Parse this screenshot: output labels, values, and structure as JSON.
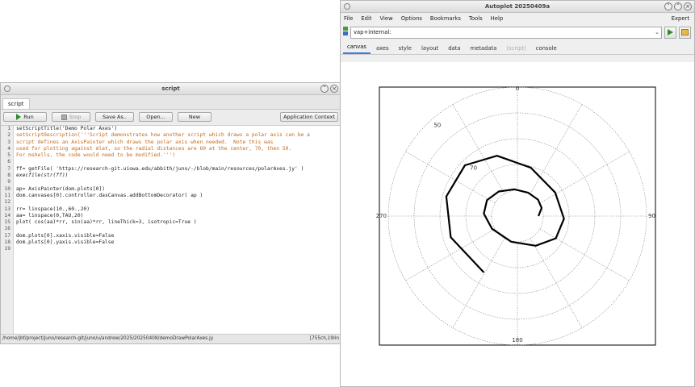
{
  "script_window": {
    "title": "script",
    "tab": "script",
    "toolbar": {
      "run": "Run",
      "stop": "Stop",
      "save_as": "Save As..",
      "open": "Open...",
      "new": "New",
      "context": "Application Context"
    },
    "code_lines": [
      "setScriptTitle('Demo Polar Axes')",
      "setScriptDescription('''Script demonstrates how another script which draws a polar axis can be a",
      "script defines an AxisPainter which draws the polar axis when needed.  Note this was",
      "used for plotting against mlat, so the radial distances are 60 at the center, 70, then 50.",
      "For mshells, the code would need to be modified.''')",
      "",
      "ff= getFile( 'https://research-git.uiowa.edu/abbith/juno/-/blob/main/resources/polarAxes.jy' )",
      "execfile(str(ff))",
      "",
      "ap= AxisPainter(dom.plots[0])",
      "dom.canvases[0].controller.dasCanvas.addBottomDecorator( ap )",
      "",
      "rr= linspace(10.,60.,20)",
      "aa= linspace(0,TAU,20)",
      "plot( cos(aa)*rr, sin(aa)*rr, lineThick=3, isotropic=True )",
      "",
      "dom.plots[0].xaxis.visible=False",
      "dom.plots[0].yaxis.visible=False",
      ""
    ],
    "status_path": "/home/jbf/project/juno/research-git/juno/u/andrew/2025/20250408/demoDrawPolarAxes.jy",
    "status_right": "[755ch,19lin"
  },
  "autoplot_window": {
    "title": "Autoplot 20250409a",
    "menu": [
      "File",
      "Edit",
      "View",
      "Options",
      "Bookmarks",
      "Tools",
      "Help"
    ],
    "expert": "Expert",
    "url_value": "vap+internal:",
    "tabs": [
      "canvas",
      "axes",
      "style",
      "layout",
      "data",
      "metadata",
      "(script)",
      "console"
    ],
    "active_tab": "canvas",
    "polar_labels": {
      "top": "0",
      "left": "270",
      "right": "90",
      "bottom": "180",
      "ring50": "50",
      "ring70": "70"
    }
  },
  "chart_data": {
    "type": "line",
    "title": "",
    "xlabel": "",
    "ylabel": "",
    "axes_visible": false,
    "series": [
      {
        "x": [
          10.0,
          11.48,
          9.75,
          5.18,
          -1.44,
          -8.85,
          -14.41,
          -15.91,
          -12.05,
          -2.95,
          8.63,
          18.22,
          22.06,
          17.91,
          6.31,
          -9.7,
          -24.87,
          -33.73,
          -31.61,
          -15.91
        ],
        "y": [
          0.0,
          3.88,
          7.81,
          11.05,
          12.69,
          11.66,
          7.55,
          1.16,
          -6.0,
          -12.15,
          -14.09,
          -10.55,
          -1.27,
          11.18,
          22.99,
          28.62,
          24.12,
          9.28,
          -10.04,
          -26.74
        ]
      }
    ],
    "polar_axis": {
      "angle_labels": [
        "0",
        "90",
        "180",
        "270"
      ],
      "radial_labels": [
        "50",
        "70"
      ],
      "grid": "dotted"
    }
  }
}
